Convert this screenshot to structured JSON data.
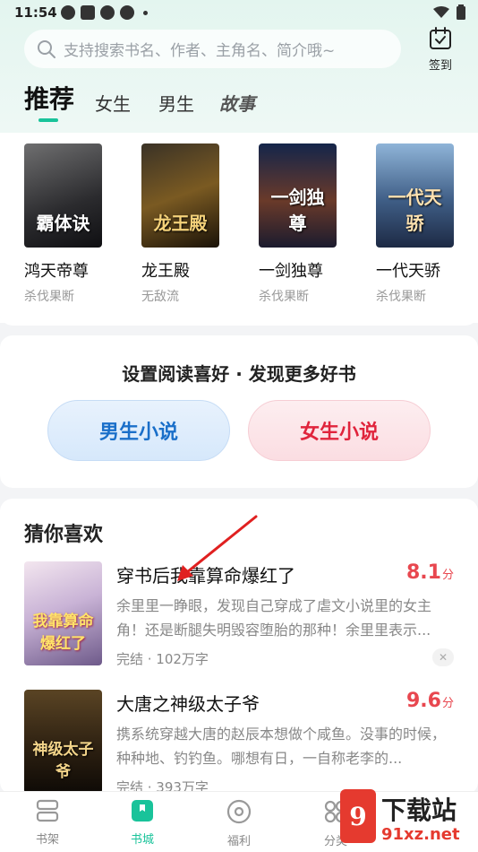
{
  "status_bar": {
    "time": "11:54"
  },
  "search": {
    "placeholder": "支持搜索书名、作者、主角名、简介哦~"
  },
  "checkin": {
    "label": "签到"
  },
  "tabs": [
    {
      "label": "推荐",
      "active": true
    },
    {
      "label": "女生"
    },
    {
      "label": "男生"
    },
    {
      "label": "故事"
    }
  ],
  "recommended": [
    {
      "title": "鸿天帝尊",
      "tag": "杀伐果断",
      "cover_text": "霸体诀"
    },
    {
      "title": "龙王殿",
      "tag": "无敌流",
      "cover_text": "龙王殿"
    },
    {
      "title": "一剑独尊",
      "tag": "杀伐果断",
      "cover_text": "一剑独尊"
    },
    {
      "title": "一代天骄",
      "tag": "杀伐果断",
      "cover_text": "一代天骄"
    }
  ],
  "preference": {
    "title": "设置阅读喜好 · 发现更多好书",
    "male_label": "男生小说",
    "female_label": "女生小说"
  },
  "guess": {
    "title": "猜你喜欢",
    "items": [
      {
        "title": "穿书后我靠算命爆红了",
        "score": "8.1",
        "score_unit": "分",
        "desc": "余里里一睁眼，发现自己穿成了虐文小说里的女主角！还是断腿失明毁容堕胎的那种！余里里表示...",
        "meta": "完结 · 102万字",
        "cover_text": "我靠算命爆红了"
      },
      {
        "title": "大唐之神级太子爷",
        "score": "9.6",
        "score_unit": "分",
        "desc": "携系统穿越大唐的赵辰本想做个咸鱼。没事的时候，种种地、钓钓鱼。哪想有日，一自称老李的...",
        "meta": "完结 · 393万字",
        "cover_text": "神级太子爷"
      }
    ]
  },
  "bottom_nav": [
    {
      "label": "书架",
      "icon": "bookshelf-icon"
    },
    {
      "label": "书城",
      "icon": "bookstore-icon",
      "active": true
    },
    {
      "label": "福利",
      "icon": "welfare-icon"
    },
    {
      "label": "分类",
      "icon": "category-icon"
    }
  ],
  "watermark": {
    "badge": "9",
    "text": "下载站",
    "url": "91xz.net"
  },
  "colors": {
    "accent": "#19c39a",
    "score": "#e8474f",
    "male": "#1a6fc9",
    "female": "#e0243c"
  }
}
